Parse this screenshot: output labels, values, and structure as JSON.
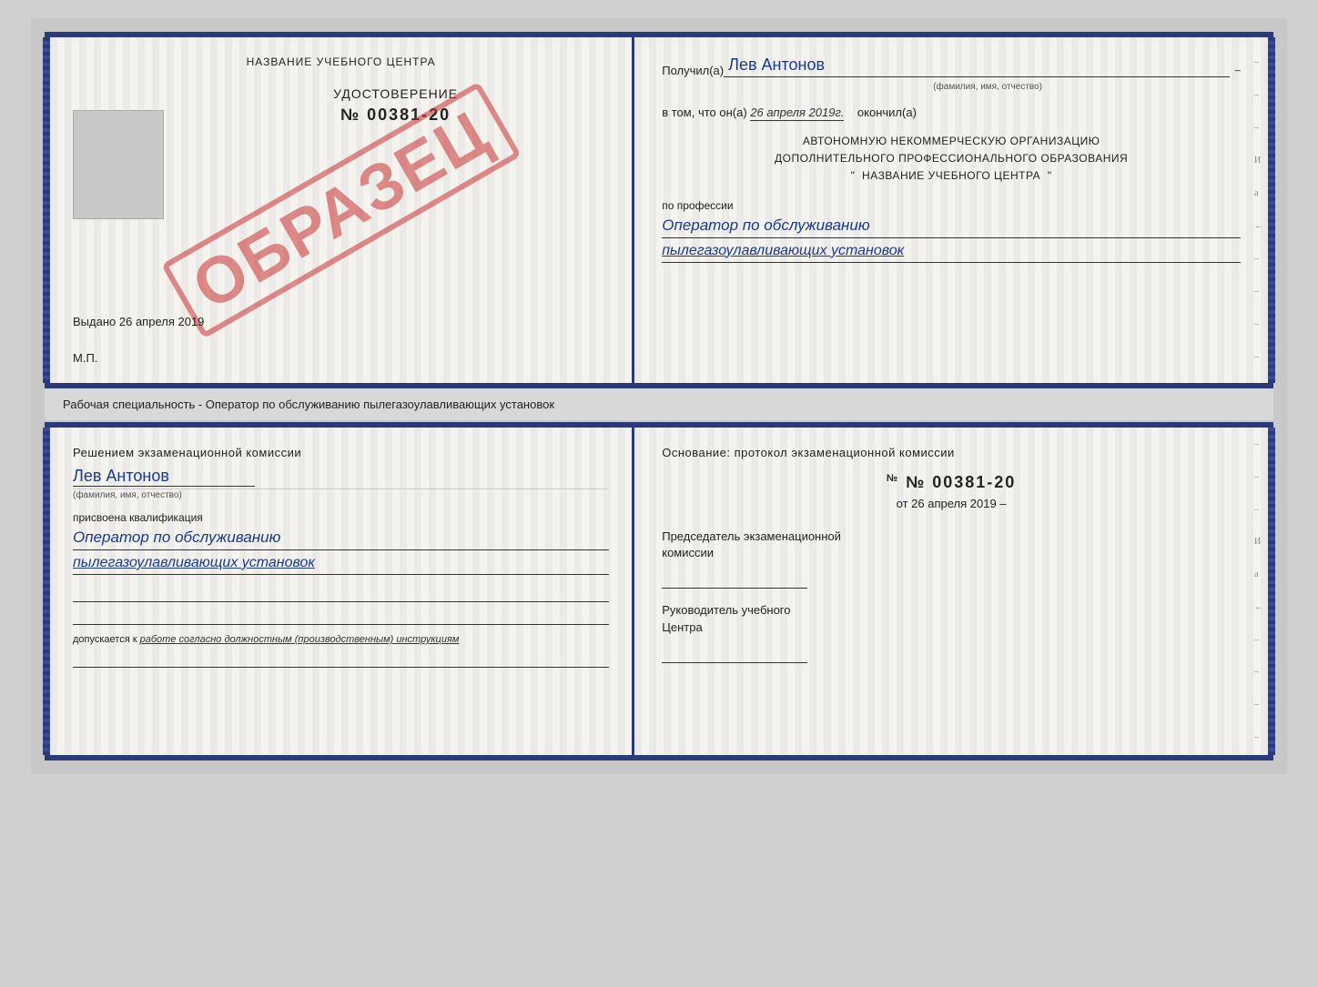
{
  "top_cert": {
    "left": {
      "school_name": "НАЗВАНИЕ УЧЕБНОГО ЦЕНТРА",
      "stamp_text": "ОБРАЗЕЦ",
      "udostoverenie_label": "УДОСТОВЕРЕНИЕ",
      "number": "№ 00381-20",
      "vydano_label": "Выдано",
      "vydano_date": "26 апреля 2019",
      "mp_label": "М.П."
    },
    "right": {
      "poluchil_label": "Получил(а)",
      "poluchil_name": "Лев Антонов",
      "poluchil_dash": "–",
      "fio_hint": "(фамилия, имя, отчество)",
      "vtom_prefix": "в том, что он(а)",
      "vtom_date": "26 апреля 2019г.",
      "vtom_suffix": "окончил(а)",
      "org_line1": "АВТОНОМНУЮ НЕКОММЕРЧЕСКУЮ ОРГАНИЗАЦИЮ",
      "org_line2": "ДОПОЛНИТЕЛЬНОГО ПРОФЕССИОНАЛЬНОГО ОБРАЗОВАНИЯ",
      "org_quote_open": "\"",
      "org_name": "НАЗВАНИЕ УЧЕБНОГО ЦЕНТРА",
      "org_quote_close": "\"",
      "po_professii": "по профессии",
      "profession1": "Оператор по обслуживанию",
      "profession2": "пылегазоулавливающих установок"
    }
  },
  "middle": {
    "text": "Рабочая специальность - Оператор по обслуживанию пылегазоулавливающих установок"
  },
  "bottom_cert": {
    "left": {
      "resheniem_text": "Решением экзаменационной комиссии",
      "name": "Лев Антонов",
      "fio_hint": "(фамилия, имя, отчество)",
      "prisvoyena": "присвоена квалификация",
      "qual1": "Оператор по обслуживанию",
      "qual2": "пылегазоулавливающих установок",
      "dopuskaetsya_prefix": "допускается к",
      "dopuskaetsya_text": "работе согласно должностным (производственным) инструкциям"
    },
    "right": {
      "osnovanie": "Основание: протокол экзаменационной комиссии",
      "number": "№ 00381-20",
      "ot_prefix": "от",
      "ot_date": "26 апреля 2019",
      "predsedatel_line1": "Председатель экзаменационной",
      "predsedatel_line2": "комиссии",
      "rukovoditel_line1": "Руководитель учебного",
      "rukovoditel_line2": "Центра"
    }
  },
  "side_dashes": [
    "–",
    "–",
    "–",
    "И",
    "а",
    "←",
    "–",
    "–",
    "–",
    "–"
  ]
}
